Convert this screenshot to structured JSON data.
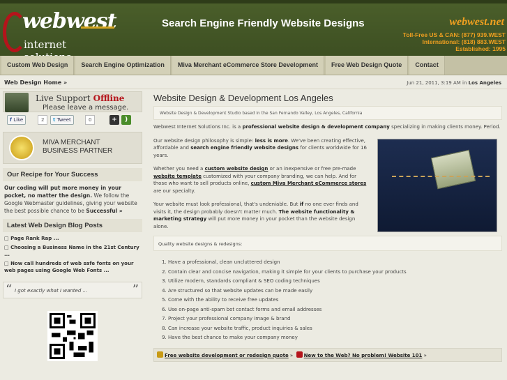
{
  "header": {
    "logo_line1": "webwest",
    "logo_line2": "internet solutions",
    "tagline": "Search Engine Friendly Website Designs",
    "brand": "webwest.net",
    "contact_lines": [
      "Toll-Free US & CAN: (877) 939.WEST",
      "International: (818) 883.WEST",
      "Established: 1995"
    ]
  },
  "nav": [
    "Custom Web Design",
    "Search Engine Optimization",
    "Miva Merchant eCommerce Store Development",
    "Free Web Design Quote",
    "Contact"
  ],
  "breadcrumb": "Web Design Home »",
  "date": {
    "text": "Jun 21, 2011, 3:19 AM in",
    "place": "Los Angeles"
  },
  "sidebar": {
    "live_title": "Live Support",
    "live_status": "Offline",
    "live_msg": "Please leave a message.",
    "like_label": "Like",
    "like_count": "2",
    "tweet_label": "Tweet",
    "tweet_count": "0",
    "miva_line1": "MIVA MERCHANT",
    "miva_line2": "BUSINESS PARTNER",
    "recipe_title": "Our Recipe for Your Success",
    "recipe_bold": "Our coding will put more money in your pocket, no matter the design.",
    "recipe_text": "We follow the Google Webmaster guidelines, giving your website the best possible chance to be",
    "recipe_end": "Successful »",
    "blog_title": "Latest Web Design Blog Posts",
    "blog_posts": [
      "Page Rank Rap ...",
      "Choosing a Business Name in the 21st Century ...",
      "Now call hundreds of web safe fonts on your web pages using Google Web Fonts ..."
    ],
    "quote": "I got exactly what I wanted ..."
  },
  "main": {
    "title": "Website Design & Development Los Angeles",
    "subtitle": "Website Design & Development Studio based in the San Fernando Valley, Los Angeles, California",
    "p1_pre": "Webwest Internet Solutions Inc. is a",
    "p1_bold": "professional website design & development company",
    "p1_post": "specializing in making clients money. Period.",
    "p2_pre": "Our website design philosophy is simple:",
    "p2_b1": "less is more",
    "p2_mid": ". We've been creating effective, affordable and",
    "p2_b2": "search engine friendly website designs",
    "p2_post": "for clients worldwide for 16 years.",
    "p3_a": "Whether you need a",
    "p3_l1": "custom website design",
    "p3_b": "or an inexpensive or free pre-made",
    "p3_l2": "website template",
    "p3_c": "customized with your company branding, we can help. And for those who want to sell products online,",
    "p3_l3": "custom Miva Merchant eCommerce stores",
    "p3_d": "are our specialty.",
    "p4_a": "Your website must look professional, that's undeniable. But",
    "p4_b1": "if",
    "p4_b": "no one ever finds and visits it, the design probably doesn't matter much.",
    "p4_b2": "The website functionality & marketing strategy",
    "p4_c": "will put more money in your pocket than the website design alone.",
    "qual_heading": "Quality website designs & redesigns:",
    "list": [
      "Have a professional, clean uncluttered design",
      "Contain clear and concise navigation, making it simple for your clients to purchase your products",
      "Utilize modern, standards compliant & SEO coding techniques",
      "Are structured so that website updates can be made easily",
      "Come with the ability to receive free updates",
      "Use on-page anti-spam bot contact forms and email addresses",
      "Project your professional company image & brand",
      "Can increase your website traffic, product inquiries & sales",
      "Have the best chance to make your company money"
    ],
    "foot_link1": "Free website development or redesign quote",
    "foot_link2": "New to the Web? No problem! Website 101",
    "foot_sep": "»"
  }
}
